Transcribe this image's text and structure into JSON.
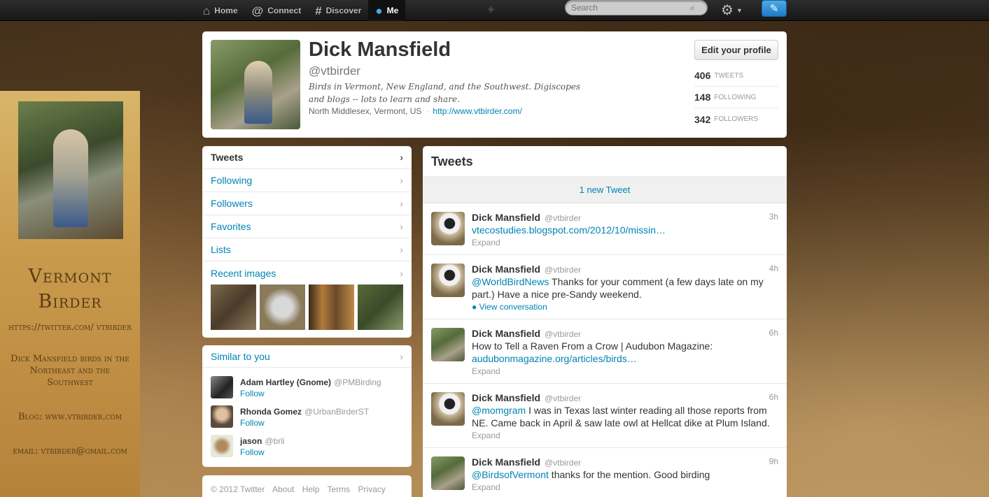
{
  "topbar": {
    "nav": [
      {
        "label": "Home",
        "icon": "home-icon"
      },
      {
        "label": "Connect",
        "icon": "at-icon"
      },
      {
        "label": "Discover",
        "icon": "hash-icon"
      },
      {
        "label": "Me",
        "icon": "person-icon"
      }
    ],
    "search_placeholder": "Search"
  },
  "background_panel": {
    "title": "Vermont Birder",
    "url": "https://twitter.com/ vtbirder",
    "desc": "Dick Mansfield birds in the Northeast and the Southwest",
    "blog": "Blog: www.vtbirder.com",
    "email": "email: vtbirder@gmail.com"
  },
  "profile": {
    "name": "Dick Mansfield",
    "handle": "@vtbirder",
    "bio": "Birds in Vermont, New England, and the Southwest. Digiscopes and blogs -- lots to learn and share.",
    "location": "North Middlesex, Vermont, US",
    "website": "http://www.vtbirder.com/",
    "edit_label": "Edit your profile",
    "stats": [
      {
        "count": "406",
        "label": "Tweets"
      },
      {
        "count": "148",
        "label": "Following"
      },
      {
        "count": "342",
        "label": "Followers"
      }
    ]
  },
  "sidenav": {
    "items": [
      "Tweets",
      "Following",
      "Followers",
      "Favorites",
      "Lists",
      "Recent images"
    ]
  },
  "similar": {
    "title": "Similar to you",
    "users": [
      {
        "name": "Adam Hartley (Gnome)",
        "handle": "@PMBirding",
        "follow": "Follow"
      },
      {
        "name": "Rhonda Gomez",
        "handle": "@UrbanBirderST",
        "follow": "Follow"
      },
      {
        "name": "jason",
        "handle": "@brli",
        "follow": "Follow"
      }
    ]
  },
  "footer": {
    "items": [
      "© 2012 Twitter",
      "About",
      "Help",
      "Terms",
      "Privacy"
    ]
  },
  "stream": {
    "title": "Tweets",
    "new_tweets": "1 new Tweet",
    "tweets": [
      {
        "name": "Dick Mansfield",
        "handle": "@vtbirder",
        "time": "3h",
        "pre": "",
        "link": "vtecostudies.blogspot.com/2012/10/missin…",
        "post": "",
        "action": "Expand"
      },
      {
        "name": "Dick Mansfield",
        "handle": "@vtbirder",
        "time": "4h",
        "pre": "",
        "link": "@WorldBirdNews",
        "post": " Thanks for your comment (a few days late on my part.) Have a nice pre-Sandy weekend.",
        "action": "View conversation"
      },
      {
        "name": "Dick Mansfield",
        "handle": "@vtbirder",
        "time": "6h",
        "pre": "How to Tell a Raven From a Crow | Audubon Magazine: ",
        "link": "audubonmagazine.org/articles/birds…",
        "post": "",
        "action": "Expand"
      },
      {
        "name": "Dick Mansfield",
        "handle": "@vtbirder",
        "time": "6h",
        "pre": "",
        "link": "@momgram",
        "post": " I was in Texas last winter reading all those reports from NE. Came back in April & saw late owl at Hellcat dike at Plum Island.",
        "action": "Expand"
      },
      {
        "name": "Dick Mansfield",
        "handle": "@vtbirder",
        "time": "9h",
        "pre": "",
        "link": "@BirdsofVermont",
        "post": " thanks for the mention. Good birding",
        "action": "Expand"
      }
    ]
  },
  "colors": {
    "link": "#0084b4",
    "topbar": "#1f1f1f",
    "accent": "#4aa8e8"
  }
}
